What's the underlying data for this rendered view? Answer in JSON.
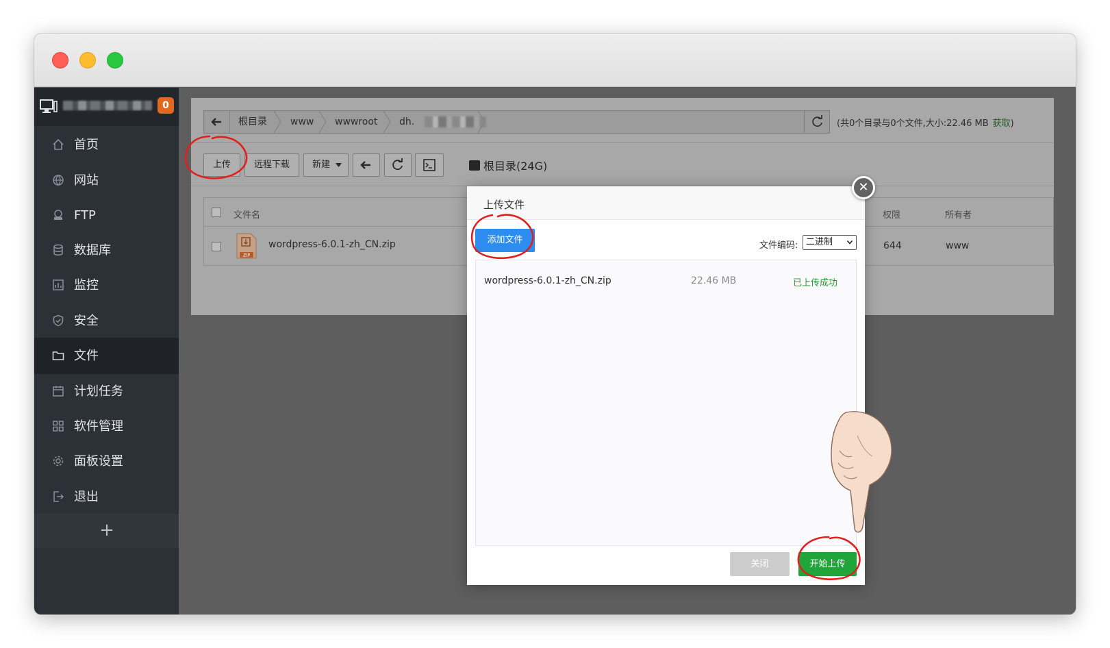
{
  "sidebar": {
    "badge": "0",
    "items": [
      {
        "label": "首页",
        "icon": "home-icon"
      },
      {
        "label": "网站",
        "icon": "globe-icon"
      },
      {
        "label": "FTP",
        "icon": "ftp-icon"
      },
      {
        "label": "数据库",
        "icon": "database-icon"
      },
      {
        "label": "监控",
        "icon": "monitor-chart-icon"
      },
      {
        "label": "安全",
        "icon": "shield-icon"
      },
      {
        "label": "文件",
        "icon": "folder-icon"
      },
      {
        "label": "计划任务",
        "icon": "calendar-icon"
      },
      {
        "label": "软件管理",
        "icon": "grid-icon"
      },
      {
        "label": "面板设置",
        "icon": "gear-icon"
      },
      {
        "label": "退出",
        "icon": "logout-icon"
      }
    ],
    "active_item": "文件",
    "add_label": "+"
  },
  "breadcrumb": {
    "segments": [
      "根目录",
      "www",
      "wwwroot",
      "dh."
    ]
  },
  "summary": {
    "text": "(共0个目录与0个文件,大小:22.46 MB",
    "link": "获取",
    "close_paren": ")"
  },
  "toolbar": {
    "upload_label": "上传",
    "remote_download_label": "远程下载",
    "new_label": "新建",
    "disk_label": "根目录(24G)"
  },
  "table": {
    "columns": [
      "文件名",
      "权限",
      "所有者"
    ],
    "rows": [
      {
        "name": "wordpress-6.0.1-zh_CN.zip",
        "permission": "644",
        "owner": "www",
        "icon_label": "ZIP"
      }
    ]
  },
  "modal": {
    "title": "上传文件",
    "add_file_label": "添加文件",
    "encoding_label": "文件编码:",
    "encoding_value": "二进制",
    "files": [
      {
        "name": "wordpress-6.0.1-zh_CN.zip",
        "size": "22.46 MB",
        "status": "已上传成功"
      }
    ],
    "close_label": "关闭",
    "start_label": "开始上传",
    "close_x": "✕"
  },
  "colors": {
    "accent_blue": "#2d8cf0",
    "success_green": "#20a53a",
    "annotation_red": "#e0201f",
    "badge_orange": "#e0681f"
  }
}
